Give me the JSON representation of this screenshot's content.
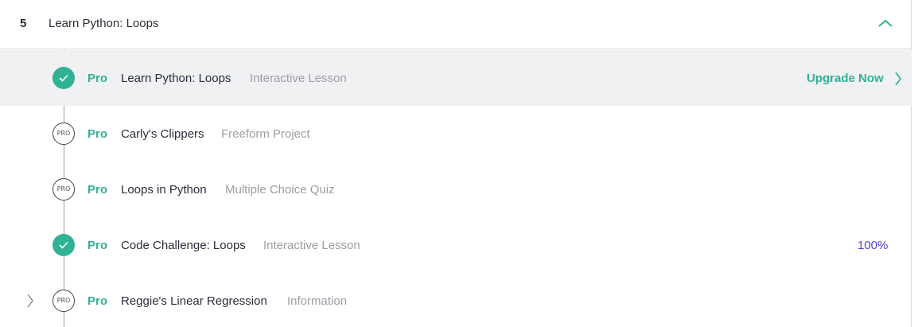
{
  "module": {
    "number": "5",
    "title": "Learn Python: Loops",
    "collapse_icon": "chevron-up-icon"
  },
  "items": [
    {
      "status": "complete",
      "pro": "Pro",
      "title": "Learn Python: Loops",
      "type": "Interactive Lesson",
      "action": "Upgrade Now"
    },
    {
      "status": "locked",
      "badge": "PRO",
      "pro": "Pro",
      "title": "Carly's Clippers",
      "type": "Freeform Project"
    },
    {
      "status": "locked",
      "badge": "PRO",
      "pro": "Pro",
      "title": "Loops in Python",
      "type": "Multiple Choice Quiz"
    },
    {
      "status": "complete",
      "pro": "Pro",
      "title": "Code Challenge: Loops",
      "type": "Interactive Lesson",
      "progress": "100%"
    },
    {
      "status": "locked",
      "badge": "PRO",
      "pro": "Pro",
      "title": "Reggie's Linear Regression",
      "type": "Information"
    }
  ],
  "colors": {
    "accent": "#31b196",
    "progress": "#4b3fd6",
    "highlight_bg": "#f0f1f2",
    "muted_text": "#9c9ea4"
  }
}
